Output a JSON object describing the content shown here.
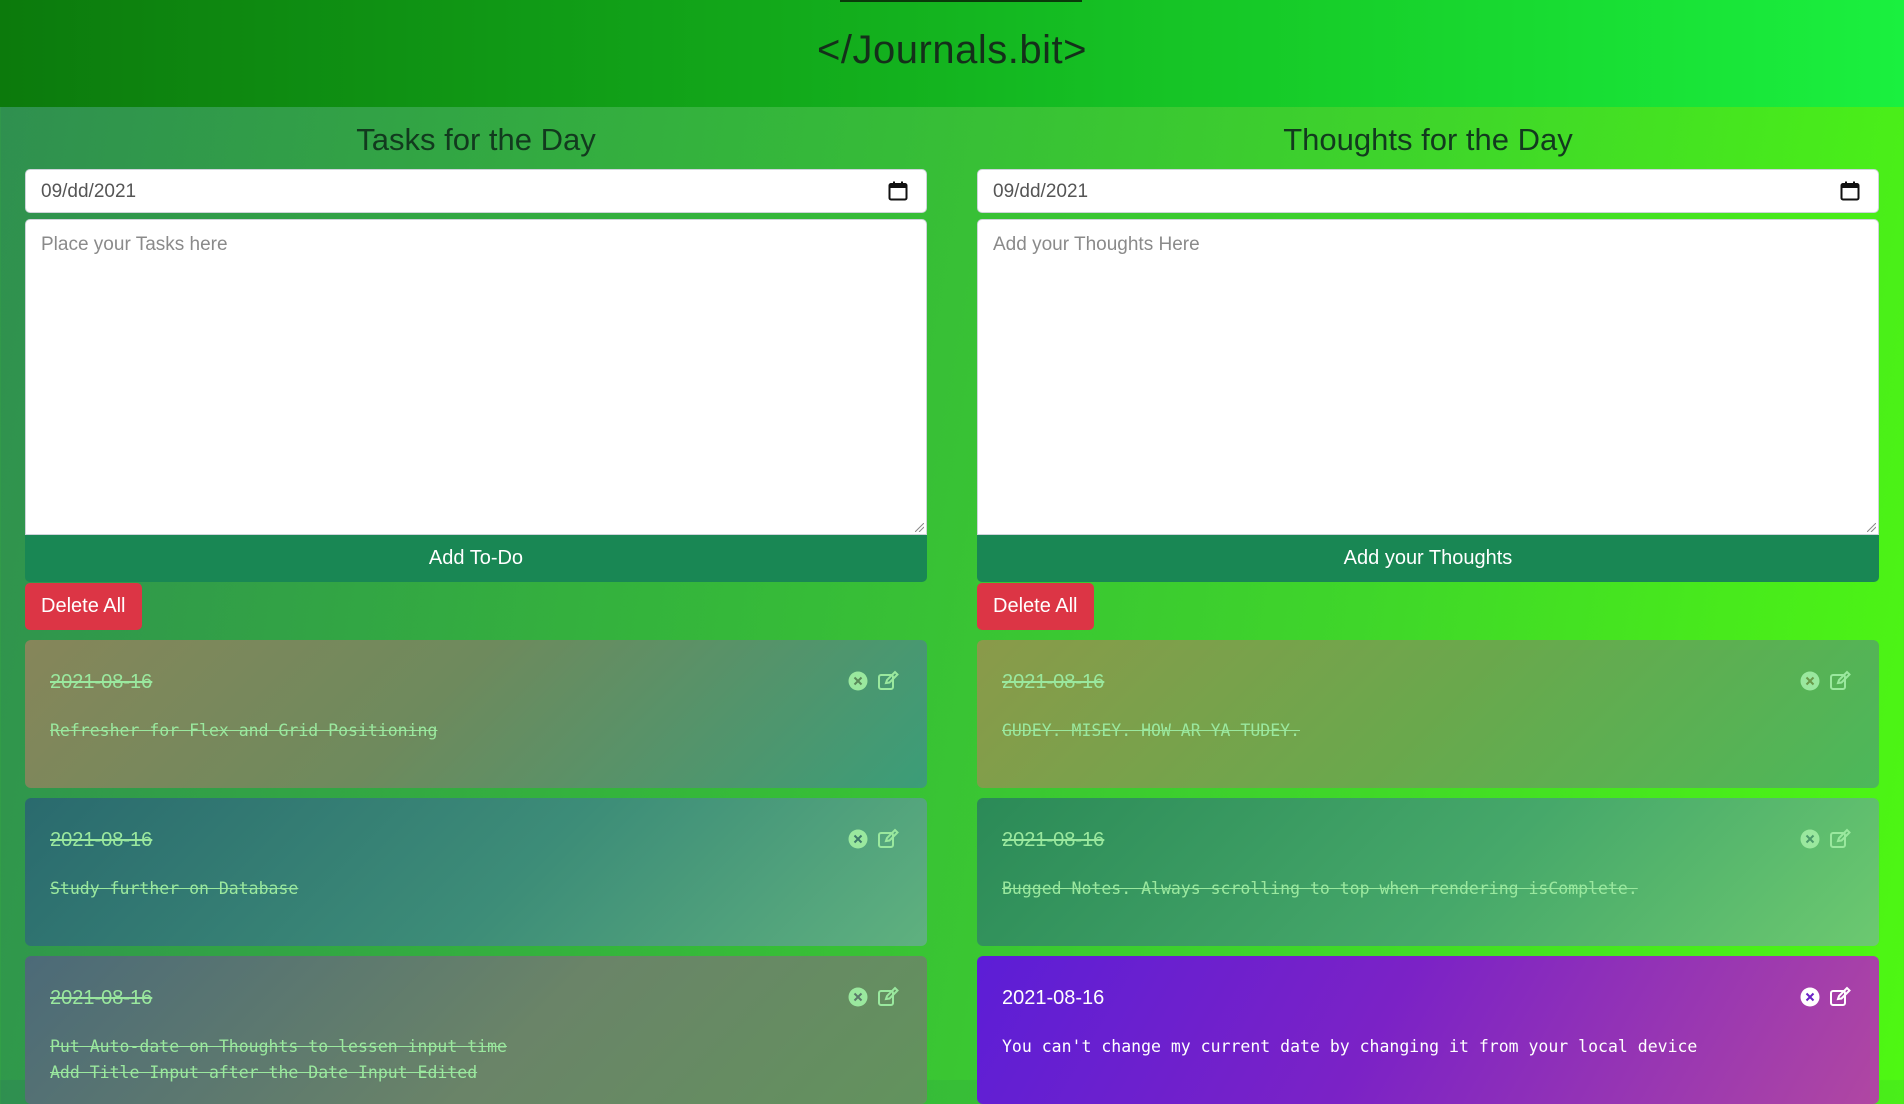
{
  "header": {
    "title": "</Journals.bit>"
  },
  "tasks": {
    "heading": "Tasks for the Day",
    "date_value": "09/dd/2021",
    "textarea_placeholder": "Place your Tasks here",
    "add_label": "Add To-Do",
    "delete_all_label": "Delete All",
    "cards": [
      {
        "date": "2021-08-16",
        "text": "Refresher for Flex and Grid Positioning",
        "completed": true
      },
      {
        "date": "2021-08-16",
        "text": "Study further on Database",
        "completed": true
      },
      {
        "date": "2021-08-16",
        "text": "Put Auto-date on Thoughts to lessen input time\nAdd Title Input after the Date Input Edited",
        "completed": true
      }
    ]
  },
  "thoughts": {
    "heading": "Thoughts for the Day",
    "date_value": "09/dd/2021",
    "textarea_placeholder": "Add your Thoughts Here",
    "add_label": "Add your Thoughts",
    "delete_all_label": "Delete All",
    "cards": [
      {
        "date": "2021-08-16",
        "text": "GUDEY. MISEY. HOW AR YA TUDEY.",
        "completed": true
      },
      {
        "date": "2021-08-16",
        "text": "Bugged Notes. Always scrolling to top when rendering isComplete.",
        "completed": true
      },
      {
        "date": "2021-08-16",
        "text": "You can't change my current date by changing it from your local device",
        "completed": false
      }
    ]
  },
  "icons": {
    "calendar": "calendar-icon",
    "close": "close-circle-icon",
    "edit": "edit-icon"
  },
  "colors": {
    "add_button": "#198754",
    "delete_button": "#dc3545",
    "completed_text": "#9ae89e"
  }
}
